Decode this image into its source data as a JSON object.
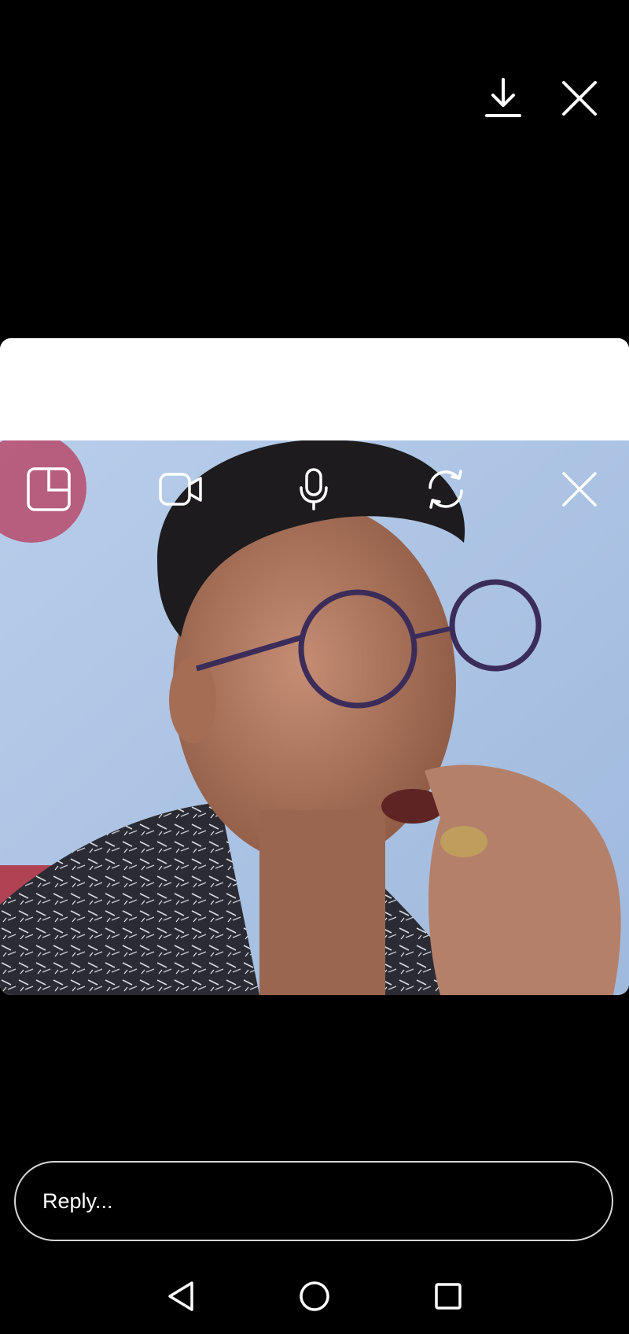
{
  "header": {
    "icons": [
      "download-icon",
      "close-icon"
    ]
  },
  "video": {
    "controls": [
      "picture-in-picture-icon",
      "video-camera-icon",
      "microphone-icon",
      "switch-camera-icon",
      "close-icon"
    ]
  },
  "reply": {
    "placeholder": "Reply..."
  },
  "nav": {
    "icons": [
      "back-triangle-icon",
      "home-circle-icon",
      "recents-square-icon"
    ]
  },
  "colors": {
    "background": "#000000",
    "card": "#ffffff",
    "icon": "#ffffff",
    "reply_border": "#d7d7d7",
    "wall": "#a9c3e3"
  }
}
